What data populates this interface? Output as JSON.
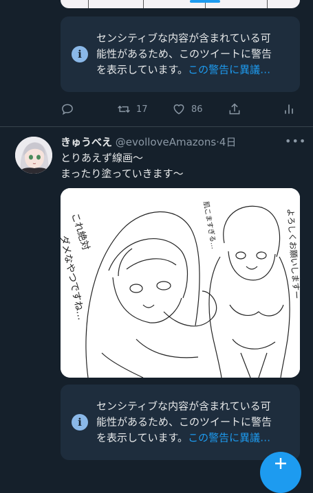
{
  "sensitive_warning": {
    "line1": "センシティブな内容が含まれている可",
    "line2": "能性があるため、このツイートに警告",
    "line3_prefix": "を表示しています。",
    "link_text": "この警告に異議…",
    "icon": "info-icon"
  },
  "prev_tweet_actions": {
    "reply_icon": "reply-icon",
    "retweet_icon": "retweet-icon",
    "retweet_count": "17",
    "like_icon": "heart-icon",
    "like_count": "86",
    "share_icon": "share-icon",
    "analytics_icon": "analytics-icon"
  },
  "tweet": {
    "display_name": "きゅうべえ",
    "handle": "@evolloveAmazons",
    "separator": "·",
    "time": "4日",
    "more_icon": "more-icon",
    "text_line1": "とりあえず線画〜",
    "text_line2": "まったり塗っていきます〜",
    "media": {
      "speech_left": "これ絶対ダメなやつですね…",
      "speech_top": "肌こますぎる…",
      "speech_right": "よろしくお願いしますー"
    }
  },
  "compose_fab": {
    "icon": "compose-icon"
  },
  "colors": {
    "background": "#15202b",
    "accent": "#1d9bf0",
    "card": "#1e2d3d",
    "muted": "#8b98a5"
  }
}
